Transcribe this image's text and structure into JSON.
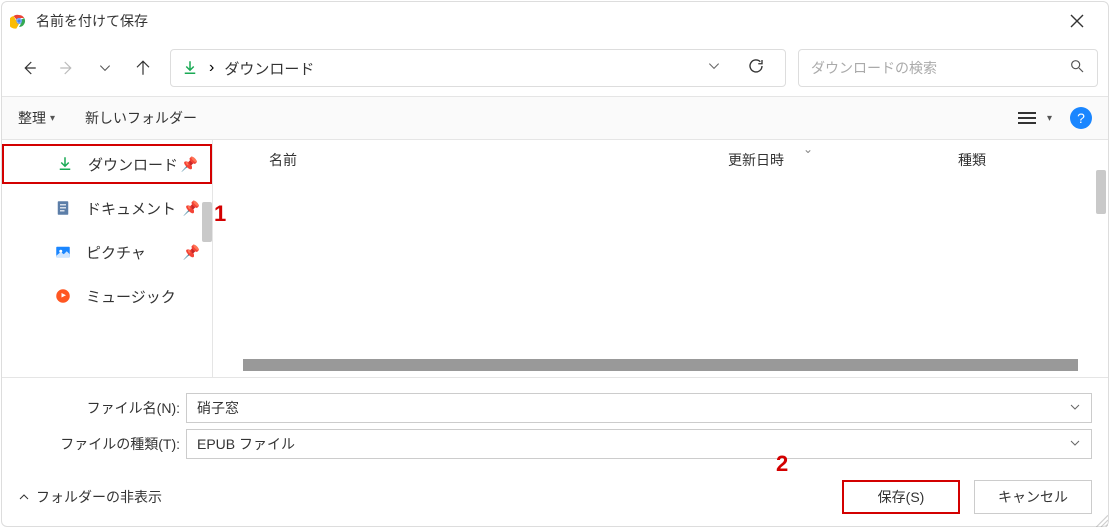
{
  "window": {
    "title": "名前を付けて保存"
  },
  "nav": {
    "breadcrumb_sep": "›",
    "breadcrumb": "ダウンロード",
    "search_placeholder": "ダウンロードの検索"
  },
  "toolbar": {
    "organize": "整理",
    "new_folder": "新しいフォルダー"
  },
  "sidebar": {
    "items": [
      {
        "label": "ダウンロード",
        "icon": "download",
        "selected": true
      },
      {
        "label": "ドキュメント",
        "icon": "document",
        "selected": false
      },
      {
        "label": "ピクチャ",
        "icon": "pictures",
        "selected": false
      },
      {
        "label": "ミュージック",
        "icon": "music",
        "selected": false
      }
    ]
  },
  "columns": {
    "name": "名前",
    "date": "更新日時",
    "type": "種類"
  },
  "form": {
    "filename_label": "ファイル名(N):",
    "filename_value": "硝子窓",
    "filetype_label": "ファイルの種類(T):",
    "filetype_value": "EPUB ファイル"
  },
  "footer": {
    "hide_folders": "フォルダーの非表示",
    "save": "保存(S)",
    "cancel": "キャンセル"
  },
  "annotations": {
    "one": "1",
    "two": "2"
  }
}
